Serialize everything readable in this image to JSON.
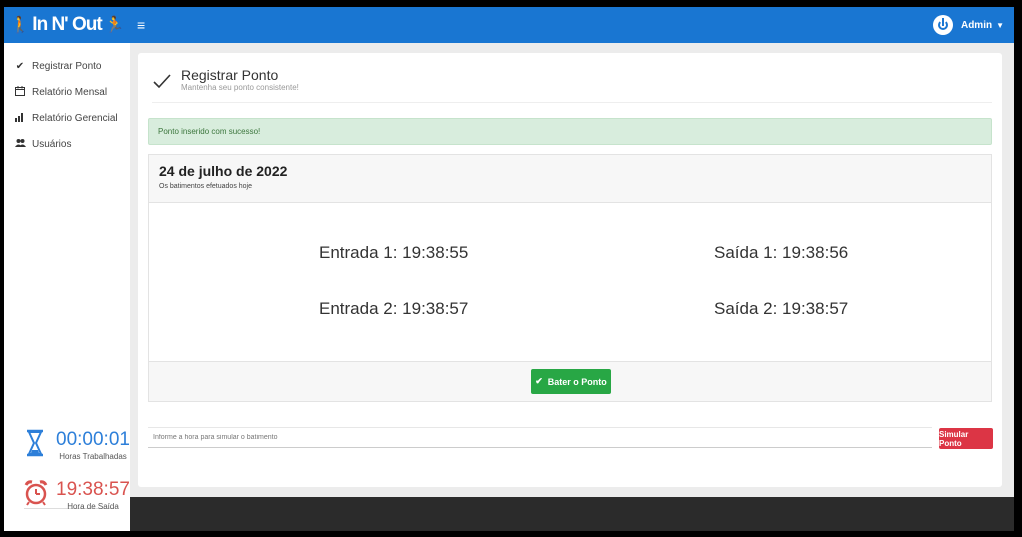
{
  "header": {
    "brand": "In N' Out",
    "brand_icon_left": "walking-person-icon",
    "brand_icon_right": "running-person-icon",
    "menu_icon": "hamburger-icon",
    "user_label": "Admin",
    "accent_color": "#1976d2"
  },
  "sidebar": {
    "items": [
      {
        "label": "Registrar Ponto",
        "icon": "check-icon"
      },
      {
        "label": "Relatório Mensal",
        "icon": "calendar-icon"
      },
      {
        "label": "Relatório Gerencial",
        "icon": "bar-chart-icon"
      },
      {
        "label": "Usuários",
        "icon": "users-icon"
      }
    ],
    "worked": {
      "value": "00:00:01",
      "caption": "Horas Trabalhadas",
      "color": "#2d7fd9"
    },
    "exit": {
      "value": "19:38:57",
      "caption": "Hora de Saída",
      "color": "#d9534f"
    }
  },
  "page": {
    "title": "Registrar Ponto",
    "subtitle": "Mantenha seu ponto consistente!"
  },
  "alert": {
    "text": "Ponto inserido com sucesso!",
    "color": "#d8eddd"
  },
  "panel": {
    "date": "24 de julho de 2022",
    "subtitle": "Os batimentos efetuados hoje",
    "punches": [
      "Entrada 1: 19:38:55",
      "Saída 1: 19:38:56",
      "Entrada 2: 19:38:57",
      "Saída 2: 19:38:57"
    ],
    "button_label": "Bater o Ponto",
    "button_color": "#28a745"
  },
  "simulate": {
    "placeholder": "Informe a hora para simular o batimento",
    "button_label": "Simular Ponto",
    "button_color": "#dc3545"
  }
}
